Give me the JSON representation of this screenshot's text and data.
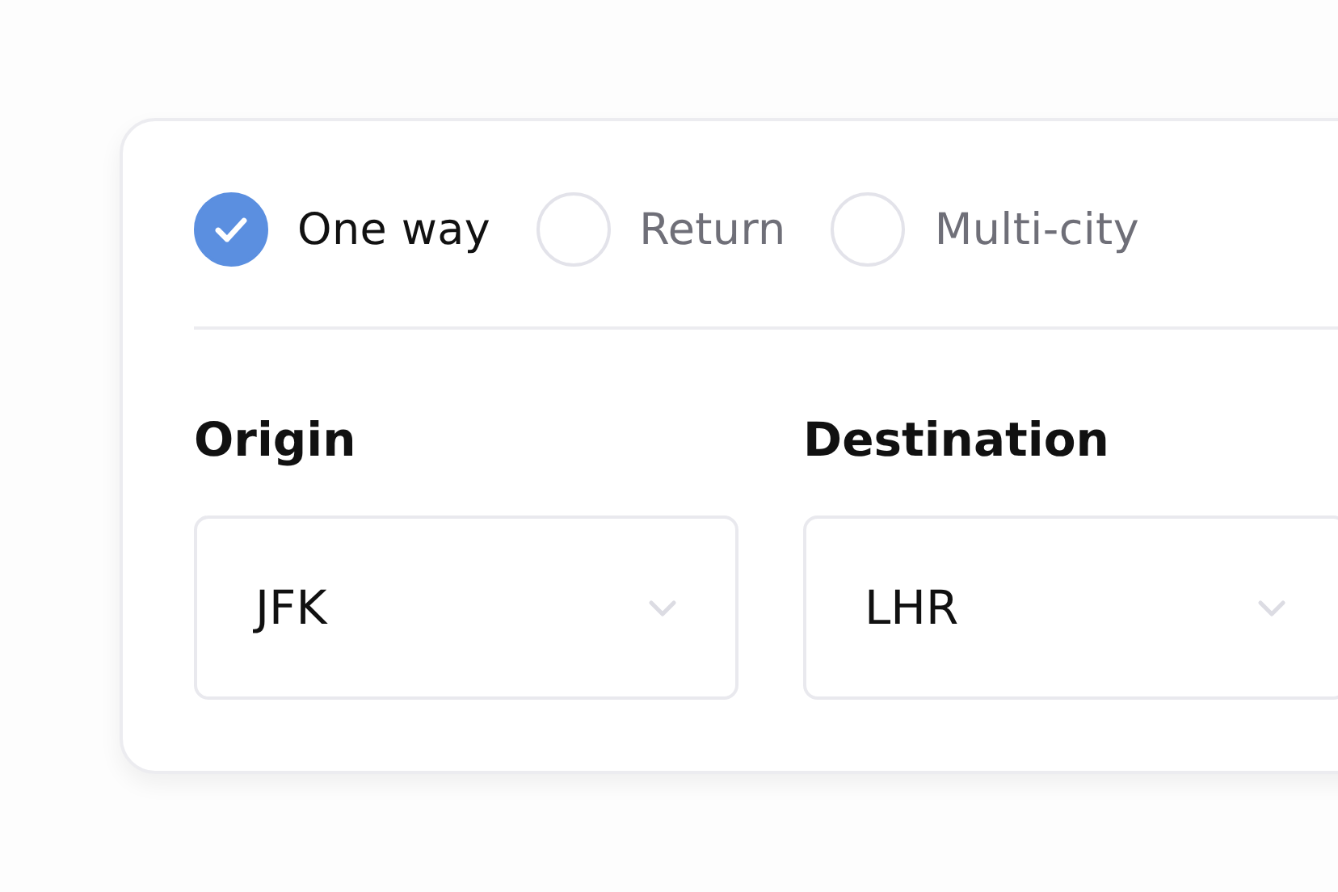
{
  "trip_types": [
    {
      "label": "One way",
      "selected": true
    },
    {
      "label": "Return",
      "selected": false
    },
    {
      "label": "Multi-city",
      "selected": false
    }
  ],
  "fields": [
    {
      "label": "Origin",
      "value": "JFK"
    },
    {
      "label": "Destination",
      "value": "LHR"
    }
  ]
}
